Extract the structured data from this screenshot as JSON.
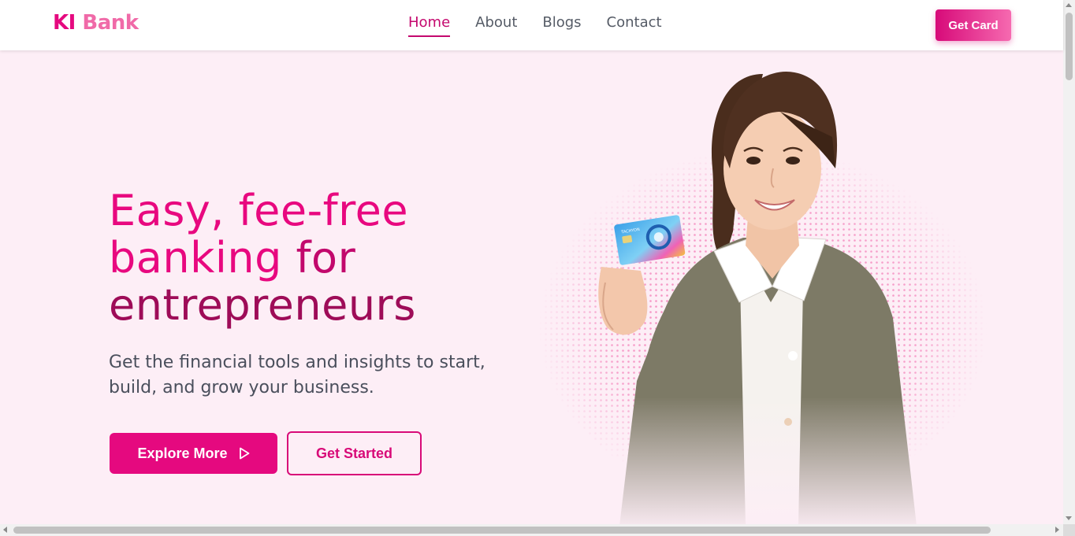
{
  "header": {
    "logo_part1": "KI",
    "logo_part2": "Bank",
    "nav": [
      {
        "label": "Home",
        "active": true
      },
      {
        "label": "About",
        "active": false
      },
      {
        "label": "Blogs",
        "active": false
      },
      {
        "label": "Contact",
        "active": false
      }
    ],
    "cta_label": "Get Card"
  },
  "hero": {
    "title_line1": "Easy, fee-free",
    "title_line2a": "banking",
    "title_line2b": "for",
    "title_line3": "entrepreneurs",
    "subtitle": "Get the financial tools and insights to start, build, and grow your business.",
    "primary_button": "Explore More",
    "secondary_button": "Get Started",
    "card_brand_text": "TACHYON"
  },
  "colors": {
    "accent": "#e5097f",
    "accent_dark": "#9e0c58",
    "background": "#fdeef6"
  },
  "icons": {
    "explore_button_icon": "play-outline-icon"
  }
}
